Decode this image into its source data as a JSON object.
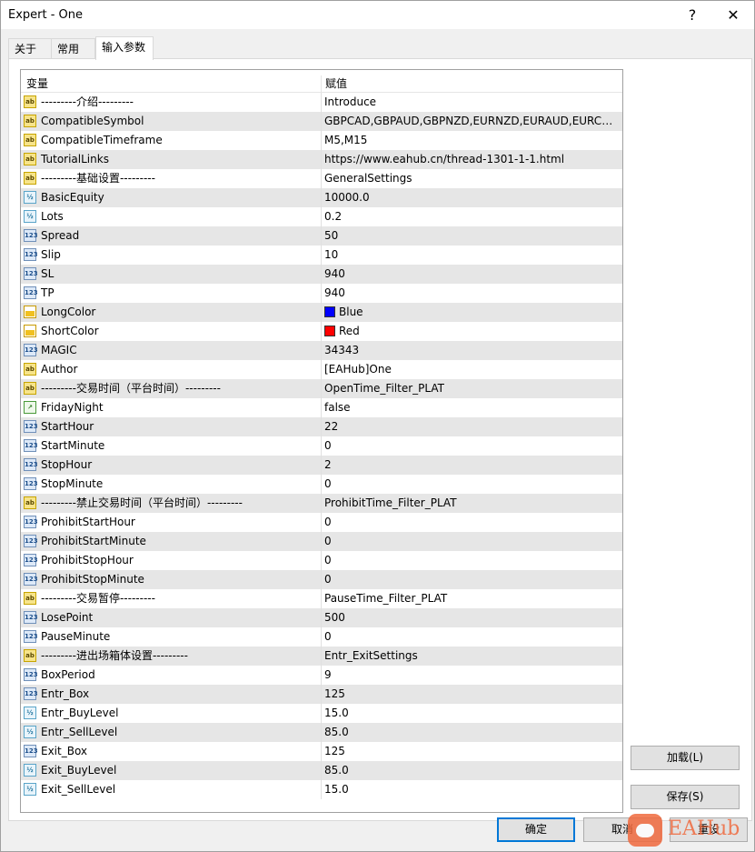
{
  "window": {
    "title": "Expert - One",
    "help_glyph": "?",
    "close_glyph": "✕"
  },
  "tabs": [
    "关于",
    "常用",
    "输入参数"
  ],
  "columns": {
    "variable": "变量",
    "value": "赋值"
  },
  "params": [
    {
      "name": "---------介绍---------",
      "value": "Introduce",
      "type": "ab"
    },
    {
      "name": "CompatibleSymbol",
      "value": "GBPCAD,GBPAUD,GBPNZD,EURNZD,EURAUD,EURCAD...",
      "type": "ab"
    },
    {
      "name": "CompatibleTimeframe",
      "value": "M5,M15",
      "type": "ab"
    },
    {
      "name": "TutorialLinks",
      "value": "https://www.eahub.cn/thread-1301-1-1.html",
      "type": "ab"
    },
    {
      "name": "---------基础设置---------",
      "value": "GeneralSettings",
      "type": "ab"
    },
    {
      "name": "BasicEquity",
      "value": "10000.0",
      "type": "dbl"
    },
    {
      "name": "Lots",
      "value": "0.2",
      "type": "dbl"
    },
    {
      "name": "Spread",
      "value": "50",
      "type": "num"
    },
    {
      "name": "Slip",
      "value": "10",
      "type": "num"
    },
    {
      "name": "SL",
      "value": "940",
      "type": "num"
    },
    {
      "name": "TP",
      "value": "940",
      "type": "num"
    },
    {
      "name": "LongColor",
      "value": "Blue",
      "type": "color",
      "swatch": "#0000ff"
    },
    {
      "name": "ShortColor",
      "value": "Red",
      "type": "color",
      "swatch": "#ff0000"
    },
    {
      "name": "MAGIC",
      "value": "34343",
      "type": "num"
    },
    {
      "name": "Author",
      "value": "[EAHub]One",
      "type": "ab"
    },
    {
      "name": "---------交易时间（平台时间）---------",
      "value": "OpenTime_Filter_PLAT",
      "type": "ab"
    },
    {
      "name": "FridayNight",
      "value": "false",
      "type": "bool"
    },
    {
      "name": "StartHour",
      "value": "22",
      "type": "num"
    },
    {
      "name": "StartMinute",
      "value": "0",
      "type": "num"
    },
    {
      "name": "StopHour",
      "value": "2",
      "type": "num"
    },
    {
      "name": "StopMinute",
      "value": "0",
      "type": "num"
    },
    {
      "name": "---------禁止交易时间（平台时间）---------",
      "value": "ProhibitTime_Filter_PLAT",
      "type": "ab"
    },
    {
      "name": "ProhibitStartHour",
      "value": "0",
      "type": "num"
    },
    {
      "name": "ProhibitStartMinute",
      "value": "0",
      "type": "num"
    },
    {
      "name": "ProhibitStopHour",
      "value": "0",
      "type": "num"
    },
    {
      "name": "ProhibitStopMinute",
      "value": "0",
      "type": "num"
    },
    {
      "name": "---------交易暂停---------",
      "value": "PauseTime_Filter_PLAT",
      "type": "ab"
    },
    {
      "name": "LosePoint",
      "value": "500",
      "type": "num"
    },
    {
      "name": "PauseMinute",
      "value": "0",
      "type": "num"
    },
    {
      "name": "---------进出场箱体设置---------",
      "value": "Entr_ExitSettings",
      "type": "ab"
    },
    {
      "name": "BoxPeriod",
      "value": "9",
      "type": "num"
    },
    {
      "name": "Entr_Box",
      "value": "125",
      "type": "num"
    },
    {
      "name": "Entr_BuyLevel",
      "value": "15.0",
      "type": "dbl"
    },
    {
      "name": "Entr_SellLevel",
      "value": "85.0",
      "type": "dbl"
    },
    {
      "name": "Exit_Box",
      "value": "125",
      "type": "num"
    },
    {
      "name": "Exit_BuyLevel",
      "value": "85.0",
      "type": "dbl"
    },
    {
      "name": "Exit_SellLevel",
      "value": "15.0",
      "type": "dbl"
    }
  ],
  "buttons": {
    "load": "加载(L)",
    "save": "保存(S)",
    "ok": "确定",
    "cancel": "取消",
    "reset": "重设"
  },
  "watermark": {
    "text": "EAHub"
  }
}
